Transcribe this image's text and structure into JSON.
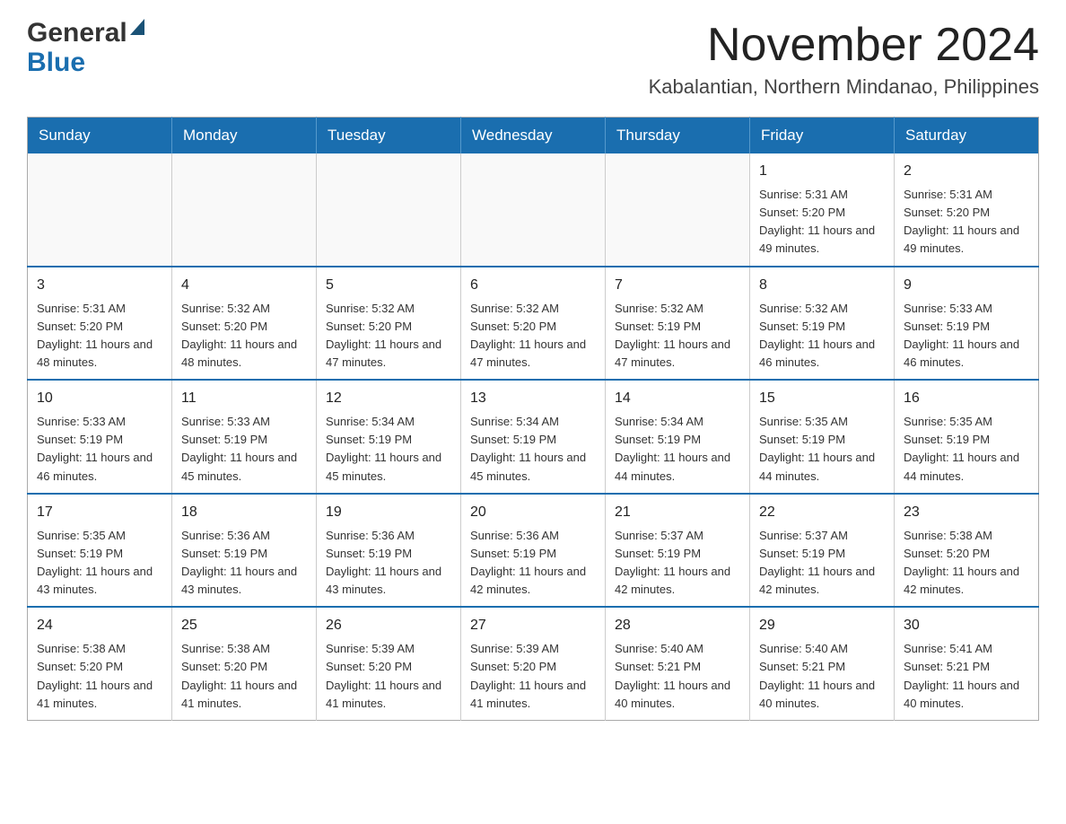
{
  "logo": {
    "general": "General",
    "blue": "Blue"
  },
  "header": {
    "month_year": "November 2024",
    "location": "Kabalantian, Northern Mindanao, Philippines"
  },
  "days_of_week": [
    "Sunday",
    "Monday",
    "Tuesday",
    "Wednesday",
    "Thursday",
    "Friday",
    "Saturday"
  ],
  "weeks": [
    [
      {
        "day": "",
        "info": ""
      },
      {
        "day": "",
        "info": ""
      },
      {
        "day": "",
        "info": ""
      },
      {
        "day": "",
        "info": ""
      },
      {
        "day": "",
        "info": ""
      },
      {
        "day": "1",
        "info": "Sunrise: 5:31 AM\nSunset: 5:20 PM\nDaylight: 11 hours and 49 minutes."
      },
      {
        "day": "2",
        "info": "Sunrise: 5:31 AM\nSunset: 5:20 PM\nDaylight: 11 hours and 49 minutes."
      }
    ],
    [
      {
        "day": "3",
        "info": "Sunrise: 5:31 AM\nSunset: 5:20 PM\nDaylight: 11 hours and 48 minutes."
      },
      {
        "day": "4",
        "info": "Sunrise: 5:32 AM\nSunset: 5:20 PM\nDaylight: 11 hours and 48 minutes."
      },
      {
        "day": "5",
        "info": "Sunrise: 5:32 AM\nSunset: 5:20 PM\nDaylight: 11 hours and 47 minutes."
      },
      {
        "day": "6",
        "info": "Sunrise: 5:32 AM\nSunset: 5:20 PM\nDaylight: 11 hours and 47 minutes."
      },
      {
        "day": "7",
        "info": "Sunrise: 5:32 AM\nSunset: 5:19 PM\nDaylight: 11 hours and 47 minutes."
      },
      {
        "day": "8",
        "info": "Sunrise: 5:32 AM\nSunset: 5:19 PM\nDaylight: 11 hours and 46 minutes."
      },
      {
        "day": "9",
        "info": "Sunrise: 5:33 AM\nSunset: 5:19 PM\nDaylight: 11 hours and 46 minutes."
      }
    ],
    [
      {
        "day": "10",
        "info": "Sunrise: 5:33 AM\nSunset: 5:19 PM\nDaylight: 11 hours and 46 minutes."
      },
      {
        "day": "11",
        "info": "Sunrise: 5:33 AM\nSunset: 5:19 PM\nDaylight: 11 hours and 45 minutes."
      },
      {
        "day": "12",
        "info": "Sunrise: 5:34 AM\nSunset: 5:19 PM\nDaylight: 11 hours and 45 minutes."
      },
      {
        "day": "13",
        "info": "Sunrise: 5:34 AM\nSunset: 5:19 PM\nDaylight: 11 hours and 45 minutes."
      },
      {
        "day": "14",
        "info": "Sunrise: 5:34 AM\nSunset: 5:19 PM\nDaylight: 11 hours and 44 minutes."
      },
      {
        "day": "15",
        "info": "Sunrise: 5:35 AM\nSunset: 5:19 PM\nDaylight: 11 hours and 44 minutes."
      },
      {
        "day": "16",
        "info": "Sunrise: 5:35 AM\nSunset: 5:19 PM\nDaylight: 11 hours and 44 minutes."
      }
    ],
    [
      {
        "day": "17",
        "info": "Sunrise: 5:35 AM\nSunset: 5:19 PM\nDaylight: 11 hours and 43 minutes."
      },
      {
        "day": "18",
        "info": "Sunrise: 5:36 AM\nSunset: 5:19 PM\nDaylight: 11 hours and 43 minutes."
      },
      {
        "day": "19",
        "info": "Sunrise: 5:36 AM\nSunset: 5:19 PM\nDaylight: 11 hours and 43 minutes."
      },
      {
        "day": "20",
        "info": "Sunrise: 5:36 AM\nSunset: 5:19 PM\nDaylight: 11 hours and 42 minutes."
      },
      {
        "day": "21",
        "info": "Sunrise: 5:37 AM\nSunset: 5:19 PM\nDaylight: 11 hours and 42 minutes."
      },
      {
        "day": "22",
        "info": "Sunrise: 5:37 AM\nSunset: 5:19 PM\nDaylight: 11 hours and 42 minutes."
      },
      {
        "day": "23",
        "info": "Sunrise: 5:38 AM\nSunset: 5:20 PM\nDaylight: 11 hours and 42 minutes."
      }
    ],
    [
      {
        "day": "24",
        "info": "Sunrise: 5:38 AM\nSunset: 5:20 PM\nDaylight: 11 hours and 41 minutes."
      },
      {
        "day": "25",
        "info": "Sunrise: 5:38 AM\nSunset: 5:20 PM\nDaylight: 11 hours and 41 minutes."
      },
      {
        "day": "26",
        "info": "Sunrise: 5:39 AM\nSunset: 5:20 PM\nDaylight: 11 hours and 41 minutes."
      },
      {
        "day": "27",
        "info": "Sunrise: 5:39 AM\nSunset: 5:20 PM\nDaylight: 11 hours and 41 minutes."
      },
      {
        "day": "28",
        "info": "Sunrise: 5:40 AM\nSunset: 5:21 PM\nDaylight: 11 hours and 40 minutes."
      },
      {
        "day": "29",
        "info": "Sunrise: 5:40 AM\nSunset: 5:21 PM\nDaylight: 11 hours and 40 minutes."
      },
      {
        "day": "30",
        "info": "Sunrise: 5:41 AM\nSunset: 5:21 PM\nDaylight: 11 hours and 40 minutes."
      }
    ]
  ],
  "colors": {
    "header_bg": "#1a6eaf",
    "border_top": "#1a6eaf"
  }
}
